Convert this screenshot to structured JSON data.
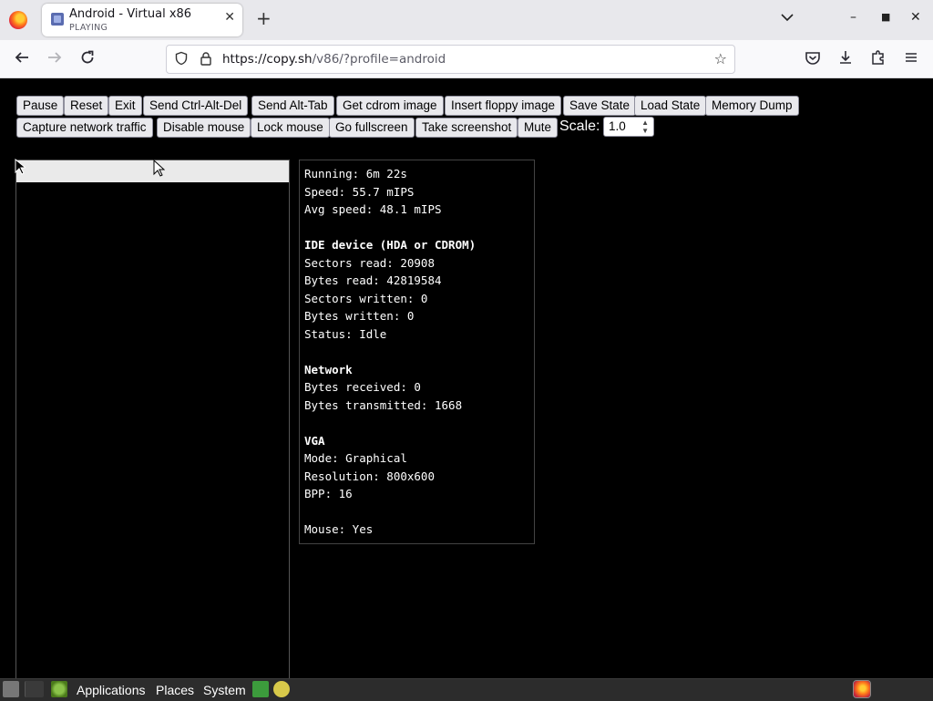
{
  "browser": {
    "tab": {
      "title": "Android - Virtual x86",
      "subtitle": "PLAYING"
    },
    "url": {
      "host": "https://copy.sh",
      "path": "/v86/?profile=android"
    }
  },
  "toolbar": {
    "row1": [
      "Pause",
      "Reset",
      "Exit",
      "Send Ctrl-Alt-Del",
      "Send Alt-Tab",
      "Get cdrom image",
      "Insert floppy image",
      "Save State",
      "Load State",
      "Memory Dump"
    ],
    "row2": [
      "Capture network traffic",
      "Disable mouse",
      "Lock mouse",
      "Go fullscreen",
      "Take screenshot",
      "Mute"
    ],
    "scale_label": "Scale:",
    "scale_value": "1.0"
  },
  "stats": {
    "running": "Running: 6m 22s",
    "speed": "Speed: 55.7 mIPS",
    "avg_speed": "Avg speed: 48.1 mIPS",
    "ide_header": "IDE device (HDA or CDROM)",
    "sectors_read": "Sectors read: 20908",
    "bytes_read": "Bytes read: 42819584",
    "sectors_written": "Sectors written: 0",
    "bytes_written": "Bytes written: 0",
    "status": "Status: Idle",
    "network_header": "Network",
    "bytes_received": "Bytes received: 0",
    "bytes_transmitted": "Bytes transmitted: 1668",
    "vga_header": "VGA",
    "mode": "Mode: Graphical",
    "resolution": "Resolution: 800x600",
    "bpp": "BPP: 16",
    "mouse": "Mouse: Yes"
  },
  "taskbar": {
    "applications": "Applications",
    "places": "Places",
    "system": "System"
  },
  "icons": {
    "browser_logo": "firefox-icon",
    "tab_close": "close-icon",
    "new_tab": "plus-icon",
    "back": "back-arrow-icon",
    "forward": "forward-arrow-icon",
    "reload": "reload-icon",
    "tracking": "shield-icon",
    "lock": "lock-icon",
    "bookmark": "star-icon",
    "pocket": "pocket-icon",
    "downloads": "download-icon",
    "extensions": "puzzle-icon",
    "menu": "hamburger-menu-icon"
  }
}
